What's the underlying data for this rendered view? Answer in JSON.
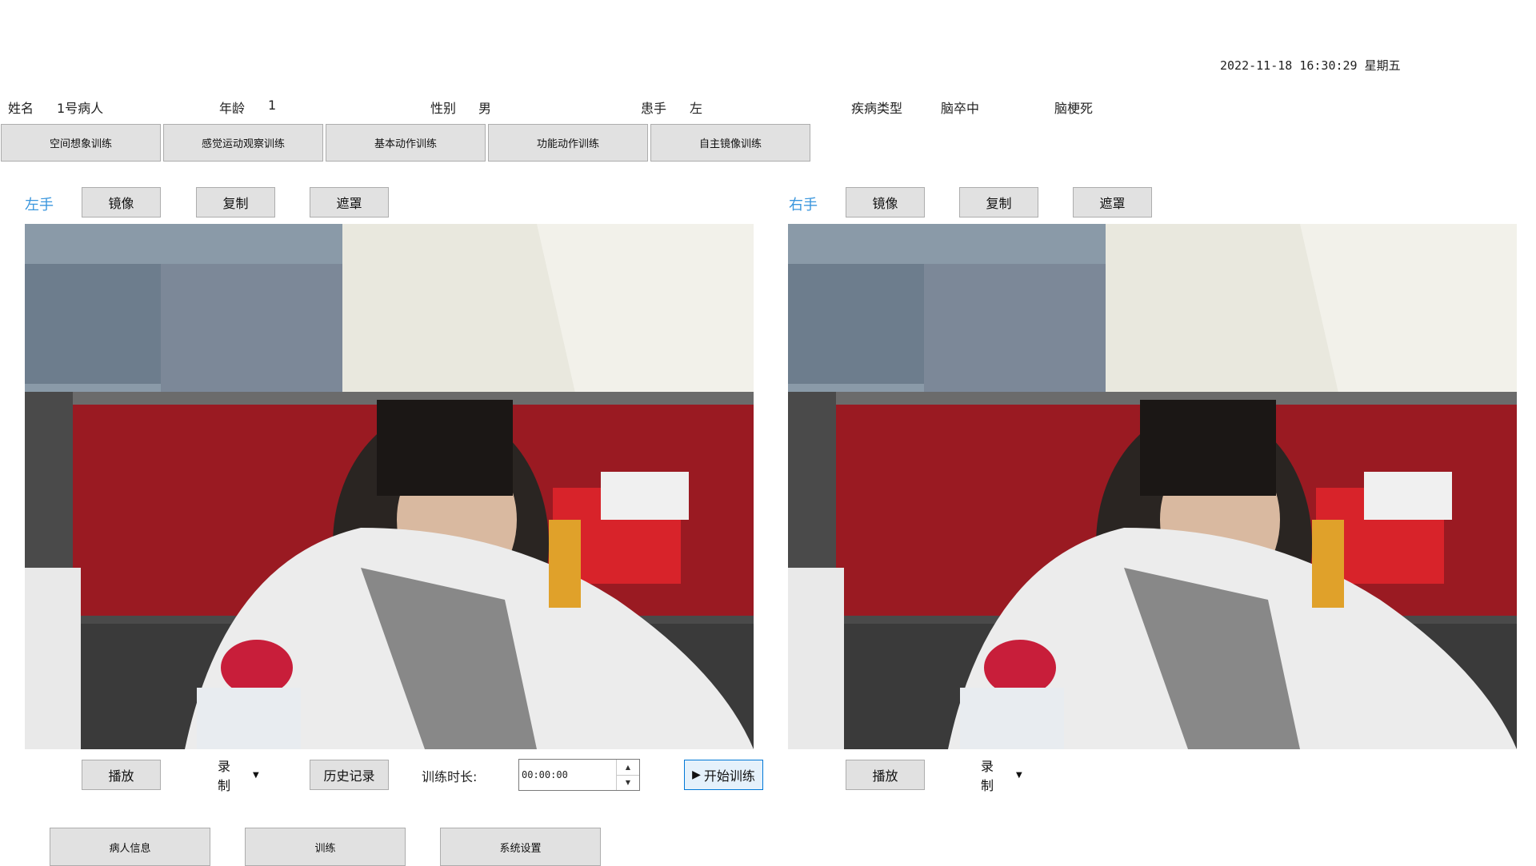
{
  "header": {
    "datetime": "2022-11-18 16:30:29 星期五"
  },
  "patient": {
    "name_label": "姓名",
    "name_value": "1号病人",
    "age_label": "年龄",
    "age_value": "1",
    "gender_label": "性别",
    "gender_value": "男",
    "affected_hand_label": "患手",
    "affected_hand_value": "左",
    "disease_type_label": "疾病类型",
    "disease_type_value": "脑卒中",
    "disease_subtype_value": "脑梗死"
  },
  "tabs": [
    {
      "label": "空间想象训练"
    },
    {
      "label": "感觉运动观察训练"
    },
    {
      "label": "基本动作训练"
    },
    {
      "label": "功能动作训练"
    },
    {
      "label": "自主镜像训练"
    }
  ],
  "left_panel": {
    "title": "左手",
    "mirror": "镜像",
    "copy": "复制",
    "mask": "遮罩",
    "play": "播放",
    "record": "录制",
    "history": "历史记录",
    "duration_label": "训练时长:",
    "duration_value": "00:00:00",
    "start": "开始训练"
  },
  "right_panel": {
    "title": "右手",
    "mirror": "镜像",
    "copy": "复制",
    "mask": "遮罩",
    "play": "播放",
    "record": "录制"
  },
  "bottom_nav": [
    {
      "label": "病人信息"
    },
    {
      "label": "训练"
    },
    {
      "label": "系统设置"
    }
  ],
  "colors": {
    "accent": "#3a96dd",
    "button_bg": "#e1e1e1",
    "button_border": "#adadad",
    "primary_border": "#0078d7"
  },
  "icons": {
    "record_dropdown": "caret-down-icon",
    "start": "play-triangle-icon",
    "spin_up": "up-arrow-icon",
    "spin_down": "down-arrow-icon"
  }
}
